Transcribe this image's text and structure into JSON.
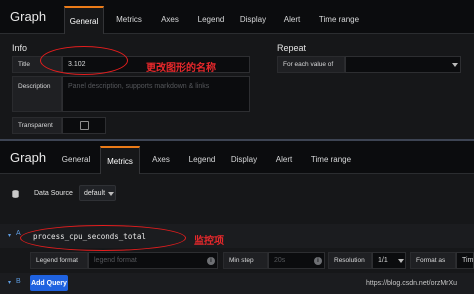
{
  "top_panel": {
    "title": "Graph",
    "tabs": [
      "General",
      "Metrics",
      "Axes",
      "Legend",
      "Display",
      "Alert",
      "Time range"
    ],
    "active_tab": "General",
    "info_section": "Info",
    "title_label": "Title",
    "title_value": "3.102",
    "description_label": "Description",
    "description_placeholder": "Panel description, supports markdown & links",
    "transparent_label": "Transparent",
    "repeat_section": "Repeat",
    "repeat_label": "For each value of",
    "annotation": "更改图形的名称"
  },
  "bottom_panel": {
    "title": "Graph",
    "tabs": [
      "General",
      "Metrics",
      "Axes",
      "Legend",
      "Display",
      "Alert",
      "Time range"
    ],
    "active_tab": "Metrics",
    "data_source_label": "Data Source",
    "data_source_value": "default",
    "query": {
      "ref_id": "A",
      "expression": "process_cpu_seconds_total",
      "annotation": "监控项",
      "legend_format_label": "Legend format",
      "legend_format_placeholder": "legend format",
      "min_step_label": "Min step",
      "min_step_placeholder": "20s",
      "resolution_label": "Resolution",
      "resolution_value": "1/1",
      "format_as_label": "Format as",
      "format_as_value": "Tim"
    },
    "next_ref_id": "B",
    "add_query_label": "Add Query",
    "watermark": "https://blog.csdn.net/orzMrXu"
  },
  "colors": {
    "accent_tab": "#eb7b18",
    "annotation_red": "#e41d1d",
    "add_query_blue": "#1f62e0",
    "query_label_blue": "#5e9ce0"
  }
}
